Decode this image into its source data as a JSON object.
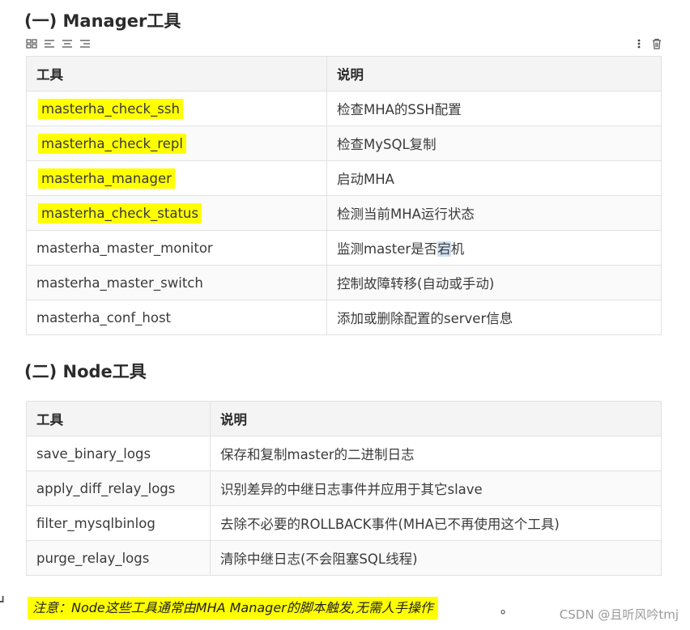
{
  "section1": {
    "title": "(一) Manager工具",
    "table": {
      "headers": [
        "工具",
        "说明"
      ],
      "rows": [
        {
          "tool": "masterha_check_ssh",
          "desc": "检查MHA的SSH配置"
        },
        {
          "tool": "masterha_check_repl",
          "desc": "检查MySQL复制"
        },
        {
          "tool": "masterha_manager",
          "desc": "启动MHA"
        },
        {
          "tool": "masterha_check_status",
          "desc": "检测当前MHA运行状态"
        },
        {
          "tool": "masterha_master_monitor",
          "desc_pre": "监测master是否",
          "desc_sel": "宕",
          "desc_post": "机"
        },
        {
          "tool": "masterha_master_switch",
          "desc": "控制故障转移(自动或手动)"
        },
        {
          "tool": "masterha_conf_host",
          "desc": "添加或删除配置的server信息"
        }
      ]
    }
  },
  "section2": {
    "title": "(二) Node工具",
    "table": {
      "headers": [
        "工具",
        "说明"
      ],
      "rows": [
        {
          "tool": "save_binary_logs",
          "desc": "保存和复制master的二进制日志"
        },
        {
          "tool": "apply_diff_relay_logs",
          "desc": "识别差异的中继日志事件并应用于其它slave"
        },
        {
          "tool": "filter_mysqlbinlog",
          "desc": "去除不必要的ROLLBACK事件(MHA已不再使用这个工具)"
        },
        {
          "tool": "purge_relay_logs",
          "desc": "清除中继日志(不会阻塞SQL线程)"
        }
      ]
    }
  },
  "note": {
    "text": "注意：Node这些工具通常由MHA Manager的脚本触发,无需人手操作",
    "tail": "。"
  },
  "watermark": "CSDN @且听风吟tmj",
  "toolbar": {
    "left_icons": [
      "grid-icon",
      "align-left-icon",
      "align-center-icon",
      "align-right-icon"
    ],
    "right_icons": [
      "more-vertical-icon",
      "trash-icon"
    ]
  },
  "colors": {
    "highlight": "#ffff00",
    "header_bg": "#f4f4f4",
    "border": "#dfe2e5",
    "watermark": "#9a9a9a"
  }
}
